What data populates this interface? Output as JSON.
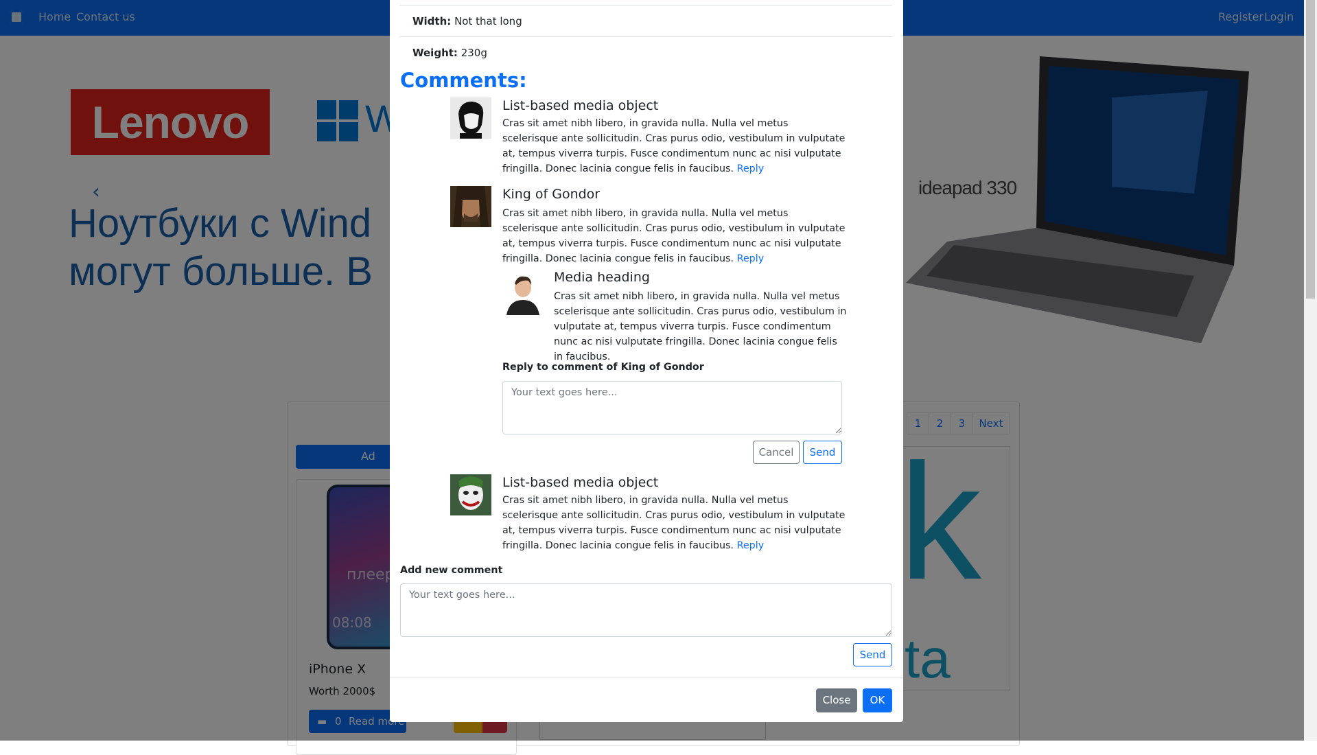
{
  "navbar": {
    "home": "Home",
    "contact": "Contact us",
    "register": "Register",
    "login": "Login"
  },
  "carousel": {
    "brand": "Lenovo",
    "windows_fragment": "W",
    "headline_line1": "Ноутбуки с Wind",
    "headline_line2": "могут больше. В",
    "product_model": "ideapad 330"
  },
  "products": {
    "add_button_fragment": "Ad",
    "phone_watermark": "плеер-ру",
    "phone_time": "08:08",
    "card_title": "iPhone X",
    "card_price": "Worth 2000$",
    "comment_count": "0",
    "read_more": "Read more",
    "right_card_text": "ta"
  },
  "pagination": [
    "1",
    "2",
    "3",
    "Next"
  ],
  "modal": {
    "specs": [
      {
        "label": "Width:",
        "value": "Not that long"
      },
      {
        "label": "Weight:",
        "value": "230g"
      }
    ],
    "comments_heading": "Comments:",
    "comments": [
      {
        "title": "List-based media object",
        "body": "Cras sit amet nibh libero, in gravida nulla. Nulla vel metus scelerisque ante sollicitudin. Cras purus odio, vestibulum in vulputate at, tempus viverra turpis. Fusce condimentum nunc ac nisi vulputate fringilla. Donec lacinia congue felis in faucibus.",
        "reply": "Reply"
      },
      {
        "title": "King of Gondor",
        "body": "Cras sit amet nibh libero, in gravida nulla. Nulla vel metus scelerisque ante sollicitudin. Cras purus odio, vestibulum in vulputate at, tempus viverra turpis. Fusce condimentum nunc ac nisi vulputate fringilla. Donec lacinia congue felis in faucibus.",
        "reply": "Reply"
      },
      {
        "title": "List-based media object",
        "body": "Cras sit amet nibh libero, in gravida nulla. Nulla vel metus scelerisque ante sollicitudin. Cras purus odio, vestibulum in vulputate at, tempus viverra turpis. Fusce condimentum nunc ac nisi vulputate fringilla. Donec lacinia congue felis in faucibus.",
        "reply": "Reply"
      }
    ],
    "nested_reply": {
      "title": "Media heading",
      "body": "Cras sit amet nibh libero, in gravida nulla. Nulla vel metus scelerisque ante sollicitudin. Cras purus odio, vestibulum in vulputate at, tempus viverra turpis. Fusce condimentum nunc ac nisi vulputate fringilla. Donec lacinia congue felis in faucibus."
    },
    "reply_form": {
      "label": "Reply to comment of King of Gondor",
      "placeholder": "Your text goes here...",
      "cancel": "Cancel",
      "send": "Send"
    },
    "new_comment_form": {
      "label": "Add new comment",
      "placeholder": "Your text goes here...",
      "send": "Send"
    },
    "footer": {
      "close": "Close",
      "ok": "OK"
    }
  },
  "colors": {
    "primary": "#0b6ff5",
    "secondary": "#6c757d",
    "navbar": "#0b6ff5"
  }
}
